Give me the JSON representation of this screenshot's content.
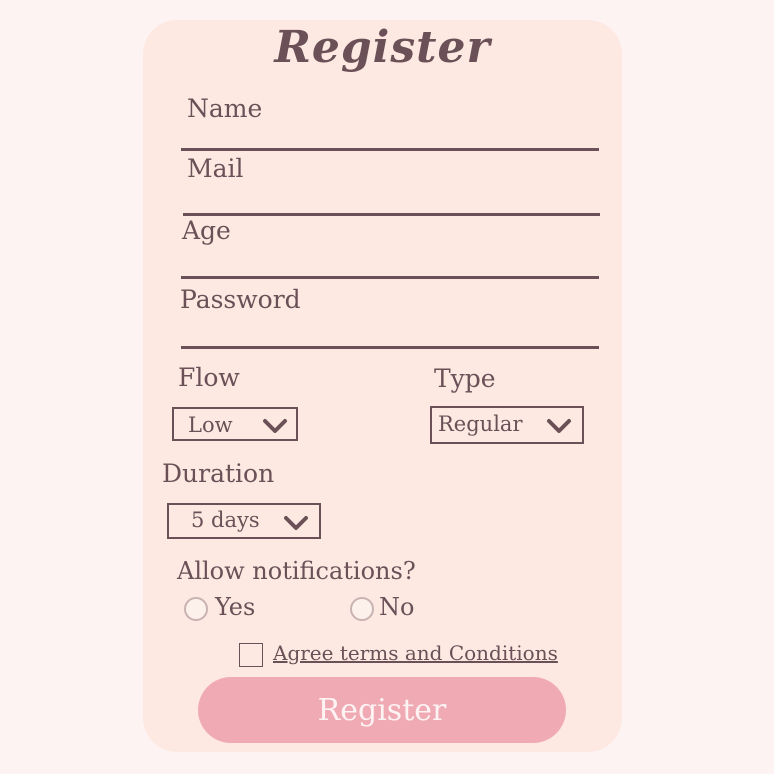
{
  "form": {
    "title": "Register",
    "fields": {
      "name": "Name",
      "mail": "Mail",
      "age": "Age",
      "password": "Password"
    },
    "flow": {
      "label": "Flow",
      "value": "Low"
    },
    "type": {
      "label": "Type",
      "value": "Regular"
    },
    "duration": {
      "label": "Duration",
      "value": "5 days"
    },
    "notifications": {
      "question": "Allow notifications?",
      "yes": "Yes",
      "no": "No"
    },
    "terms_label": "Agree terms and Conditions",
    "submit_label": "Register"
  },
  "colors": {
    "page_bg": "#fdf3f3",
    "card_bg": "#fde9e1",
    "text": "#6b5058",
    "button": "#f0aab4",
    "button_text": "#fdf3f3"
  }
}
